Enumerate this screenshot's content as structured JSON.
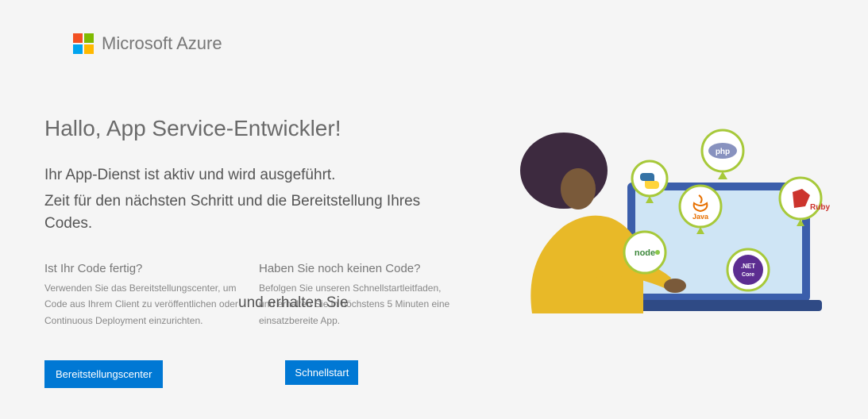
{
  "brand": "Microsoft Azure",
  "headline": "Hallo, App Service-Entwickler!",
  "sub1": "Ihr App-Dienst ist aktiv und wird ausgeführt.",
  "sub2": "Zeit für den nächsten Schritt und die Bereitstellung Ihres Codes.",
  "colLeft": {
    "q": "Ist Ihr Code fertig?",
    "desc": "Verwenden Sie das Bereitstellungscenter, um Code aus Ihrem Client zu veröffentlichen oder Continuous Deployment einzurichten.",
    "button": "Bereitstellungscenter"
  },
  "colRight": {
    "q": "Haben Sie noch keinen Code?",
    "desc": "Befolgen Sie unseren Schnellstartleitfaden, und erhalten Sie in höchstens 5 Minuten eine einsatzbereite App.",
    "button": "Schnellstart"
  },
  "bigFrag": "und erhalten Sie",
  "illus": {
    "badges": {
      "php": "php",
      "python": "python",
      "java": "Java",
      "ruby": "Ruby",
      "node": "node",
      "netcore": ".NET Core"
    }
  },
  "colors": {
    "accent": "#0078d4",
    "badgeRing": "#a7c93a",
    "laptop": "#3b5eab",
    "screen": "#cfe5f5",
    "person": "#e8b928",
    "hair": "#3d2a3f",
    "skin": "#7a5a3a"
  }
}
